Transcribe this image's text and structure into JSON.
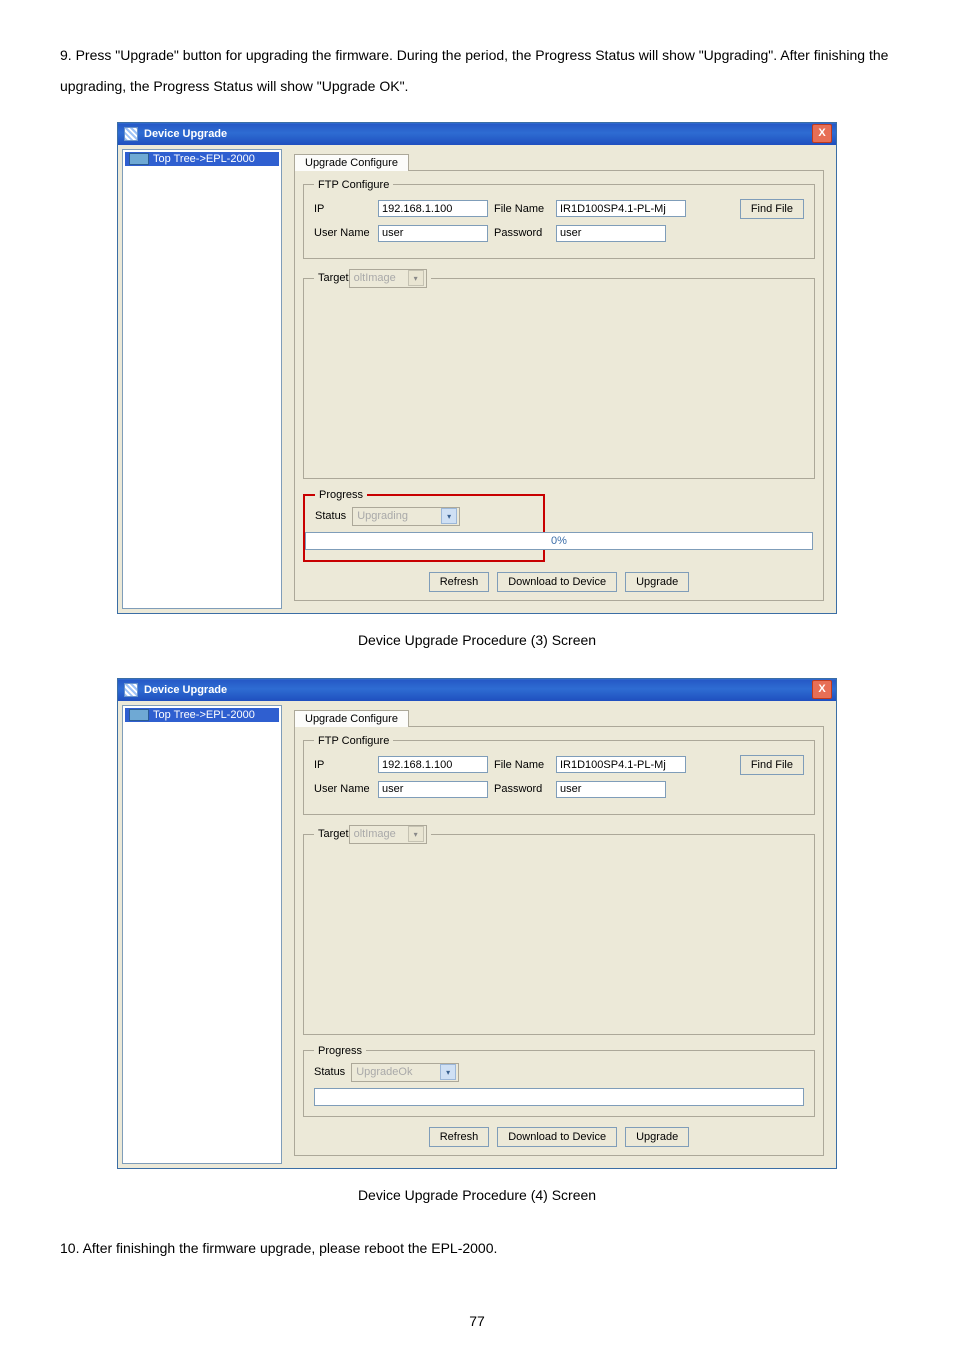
{
  "intro_text": "9. Press \"Upgrade\" button for upgrading the firmware. During the period, the Progress Status will show \"Upgrading\". After finishing the upgrading, the Progress Status will show \"Upgrade OK\".",
  "window_title": "Device Upgrade",
  "close_glyph": "X",
  "nav_item": "Top Tree->EPL-2000",
  "tab_label": "Upgrade Configure",
  "ftp": {
    "legend": "FTP Configure",
    "ip_label": "IP",
    "ip_value": "192.168.1.100",
    "filename_label": "File Name",
    "filename_value": "IR1D100SP4.1-PL-Mj",
    "findfile_btn": "Find File",
    "username_label": "User Name",
    "username_value": "user",
    "password_label": "Password",
    "password_value": "user"
  },
  "target": {
    "label": "Target",
    "value": "oltImage"
  },
  "progress": {
    "legend": "Progress",
    "status_label": "Status",
    "pct": "0%"
  },
  "status_upgrading": "Upgrading",
  "status_upgradeok": "UpgradeOk",
  "buttons": {
    "refresh": "Refresh",
    "download": "Download to Device",
    "upgrade": "Upgrade"
  },
  "caption1": "Device Upgrade Procedure (3) Screen",
  "caption2": "Device Upgrade Procedure (4) Screen",
  "outro_text": "10. After finishingh the firmware upgrade, please reboot the EPL-2000.",
  "page_number": "77"
}
